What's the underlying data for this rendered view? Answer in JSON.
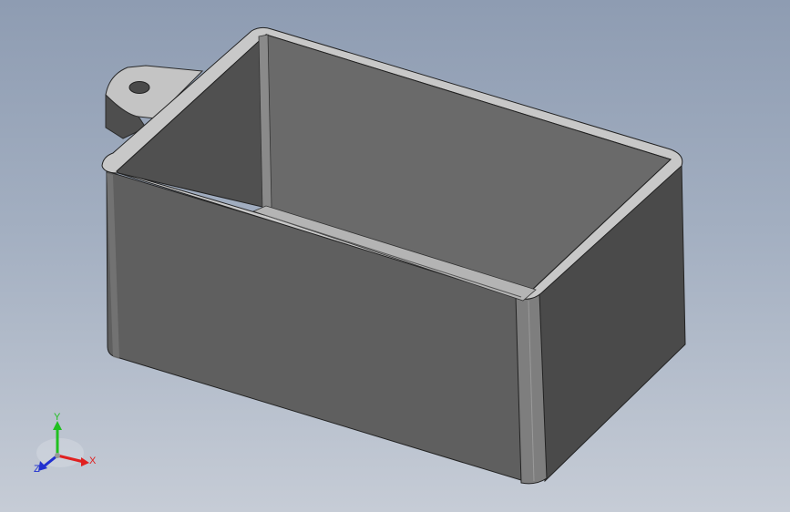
{
  "viewport": {
    "model_name": "enclosure-box-with-mounting-tabs",
    "background_colors": [
      "#8e9cb2",
      "#c6ccd6"
    ],
    "model_colors": {
      "top_rim": "#c8c8c8",
      "front_face": "#5f5f5f",
      "side_face": "#4a4a4a",
      "inner_back_wall": "#6a6a6a",
      "inner_left_wall": "#505050",
      "inner_floor_edge": "#b4b4b4",
      "edge": "#222222"
    }
  },
  "triad": {
    "x_label": "X",
    "y_label": "Y",
    "z_label": "Z",
    "x_color": "#e02020",
    "y_color": "#20c020",
    "z_color": "#2030d0"
  }
}
